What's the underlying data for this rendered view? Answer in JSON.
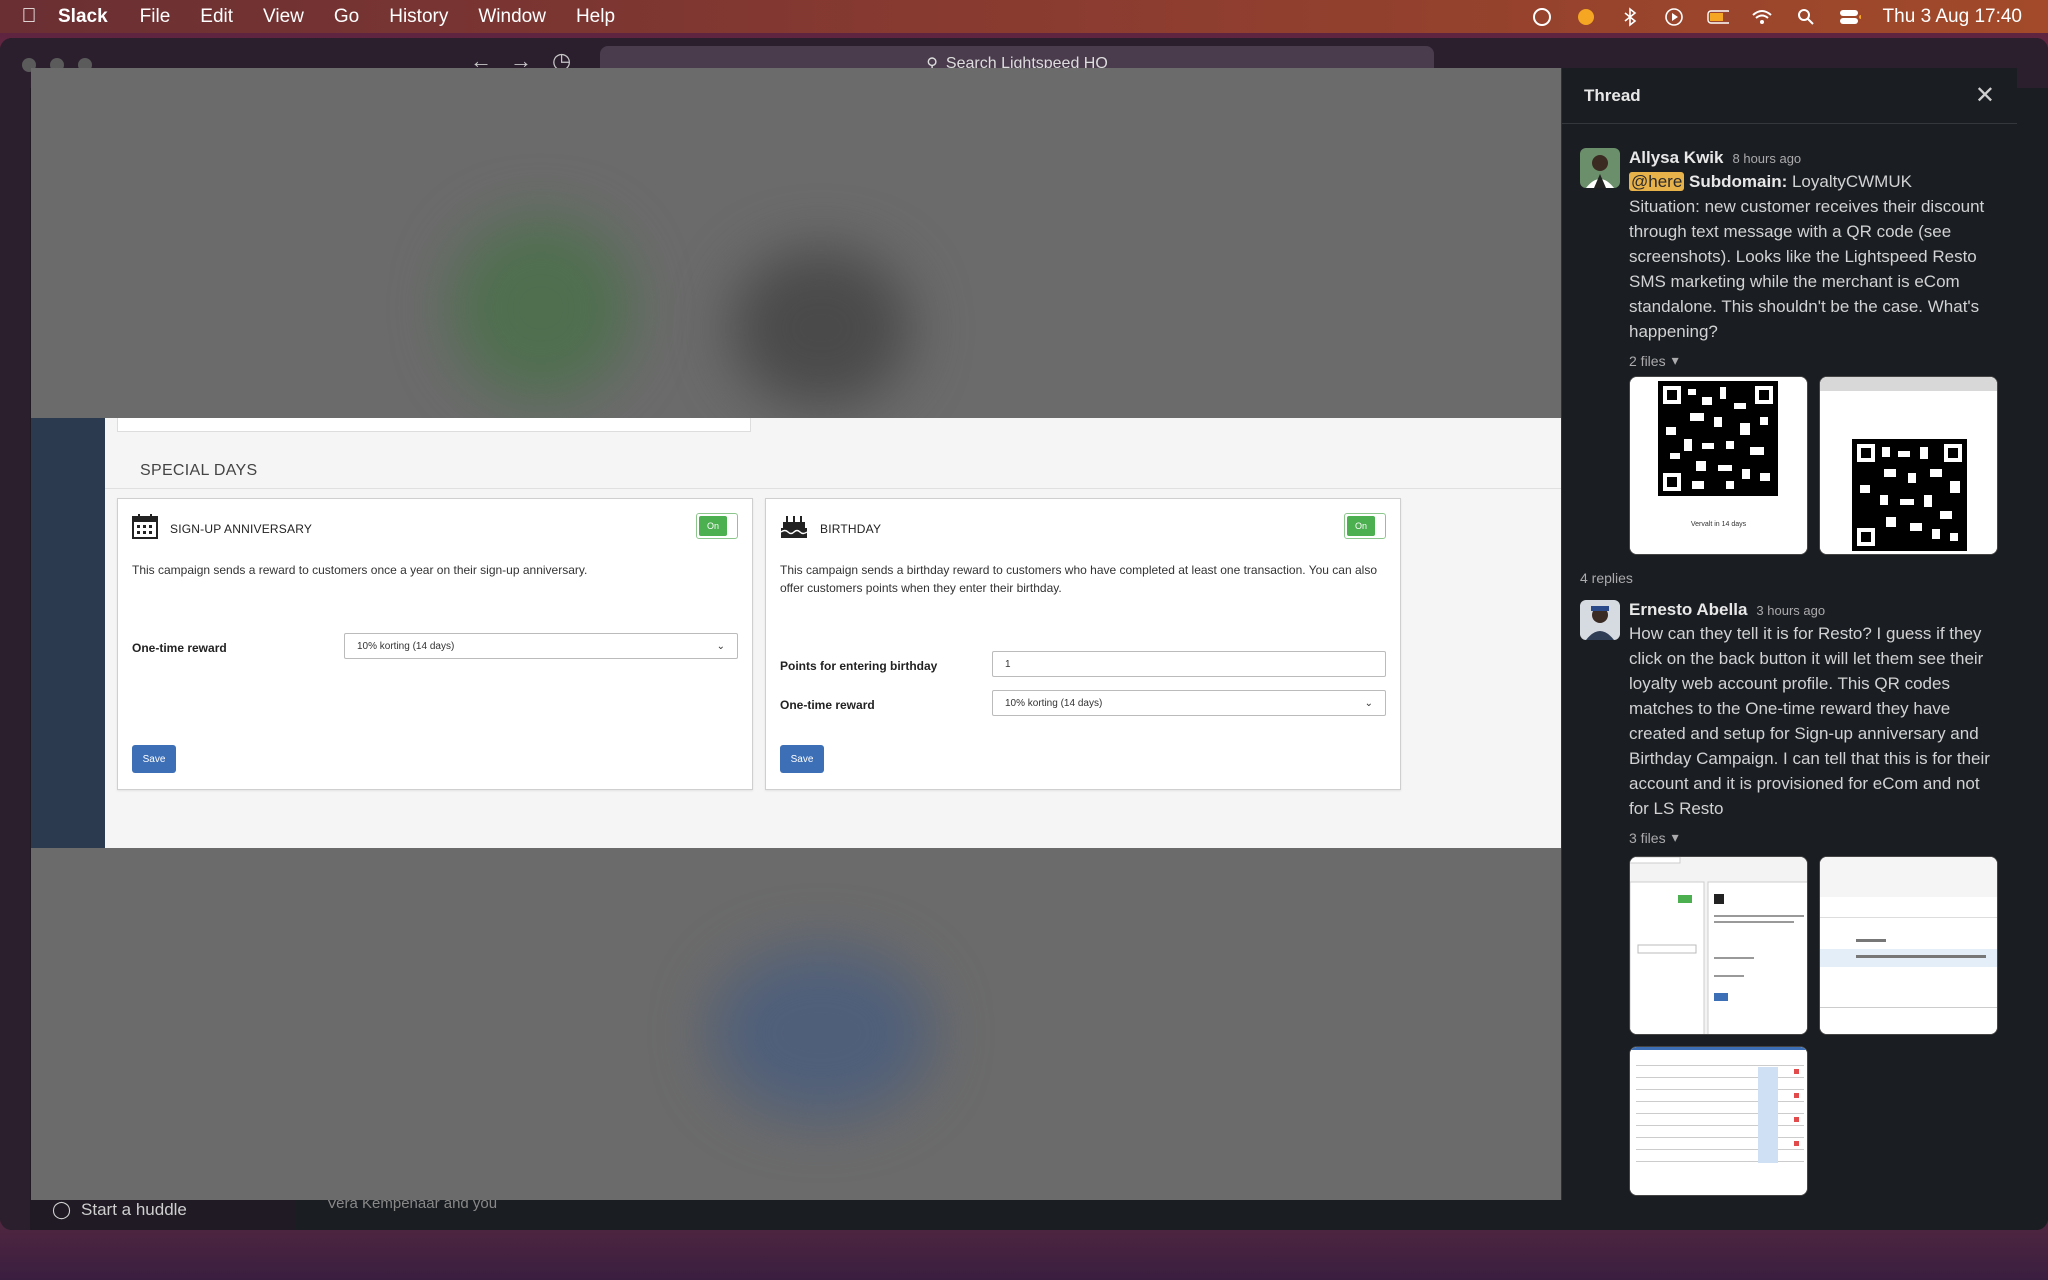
{
  "menubar": {
    "app_name": "Slack",
    "menus": [
      "File",
      "Edit",
      "View",
      "Go",
      "History",
      "Window",
      "Help"
    ],
    "clock": "Thu 3 Aug  17:40"
  },
  "slack": {
    "search_placeholder": "Search Lightspeed HQ",
    "sidebar_huddle": "Start a huddle",
    "footer_text": "Vera Kempenaar and you"
  },
  "viewer": {
    "section_title": "SPECIAL DAYS",
    "cards": [
      {
        "title": "SIGN-UP ANNIVERSARY",
        "toggle": "On",
        "description": "This campaign sends a reward to customers once a year on their sign-up anniversary.",
        "fields": [
          {
            "label": "One-time reward",
            "value": "10% korting (14 days)"
          }
        ],
        "save": "Save"
      },
      {
        "title": "BIRTHDAY",
        "toggle": "On",
        "description_line1": "This campaign sends a birthday reward to customers who have completed at least one transaction. You can also",
        "description_line2": "offer customers points when they enter their birthday.",
        "fields": [
          {
            "label": "Points for entering birthday",
            "value": "1"
          },
          {
            "label": "One-time reward",
            "value": "10% korting (14 days)"
          }
        ],
        "save": "Save"
      }
    ]
  },
  "thread": {
    "title": "Thread",
    "messages": [
      {
        "author": "Allysa Kwik",
        "time": "8 hours ago",
        "mention": "@here",
        "bold_label": "Subdomain:",
        "subdomain": " LoyaltyCWMUK",
        "text": "Situation: new customer receives their discount through text message with a QR code (see screenshots). Looks like the Lightspeed Resto SMS marketing while the merchant is eCom standalone. This shouldn't be the case. What's happening?",
        "files_label": "2 files",
        "qr_caption": "Vervalt in 14 days"
      },
      {
        "author": "Ernesto Abella",
        "time": "3 hours ago",
        "text": "How can they tell it is for Resto? I guess if they click on the back button it will let them see their loyalty web account profile. This QR codes matches to the One-time reward they have created and setup for Sign-up anniversary and Birthday Campaign. I can tell that this is for their account and it is provisioned  for eCom and not for LS Resto",
        "files_label": "3 files"
      }
    ],
    "replies_count": "4 replies"
  }
}
